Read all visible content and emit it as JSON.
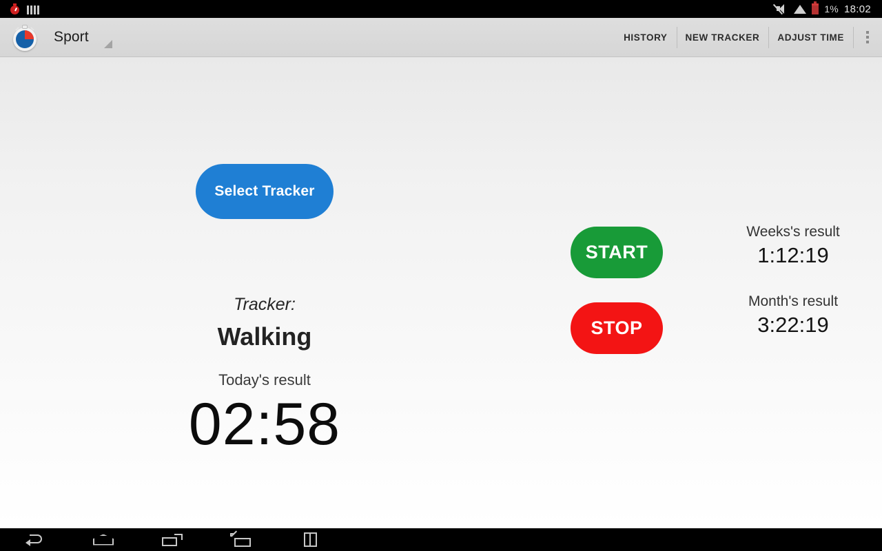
{
  "status_bar": {
    "notifications": [
      {
        "icon": "stopwatch-notification-icon"
      },
      {
        "icon": "equalizer-bars-icon"
      }
    ],
    "mute_icon": "volume-muted-icon",
    "wifi_icon": "wifi-icon",
    "battery_icon": "battery-low-icon",
    "battery_level": "1%",
    "clock": "18:02"
  },
  "action_bar": {
    "app_icon": "stopwatch-app-icon",
    "title": "Sport",
    "spinner_icon": "dropdown-triangle-icon",
    "actions": [
      {
        "label": "HISTORY",
        "name": "history"
      },
      {
        "label": "NEW TRACKER",
        "name": "new-tracker"
      },
      {
        "label": "ADJUST TIME",
        "name": "adjust-time"
      }
    ],
    "overflow_icon": "overflow-menu-icon"
  },
  "main": {
    "select_tracker_label": "Select Tracker",
    "tracker_caption": "Tracker:",
    "tracker_name": "Walking",
    "today_label": "Today's result",
    "today_time": "02:58",
    "start_label": "START",
    "stop_label": "STOP",
    "results": [
      {
        "label": "Weeks's result",
        "value": "1:12:19"
      },
      {
        "label": "Month's result",
        "value": "3:22:19"
      }
    ]
  },
  "nav_bar": {
    "buttons": [
      {
        "name": "back",
        "icon": "back-arrow-icon"
      },
      {
        "name": "home",
        "icon": "home-icon"
      },
      {
        "name": "recents",
        "icon": "recent-apps-icon"
      },
      {
        "name": "floating-window",
        "icon": "floating-window-icon"
      },
      {
        "name": "split-screen",
        "icon": "split-screen-icon"
      }
    ]
  },
  "colors": {
    "accent_blue": "#1f7fd4",
    "start_green": "#189b38",
    "stop_red": "#f31414",
    "battery_red": "#b63232"
  }
}
